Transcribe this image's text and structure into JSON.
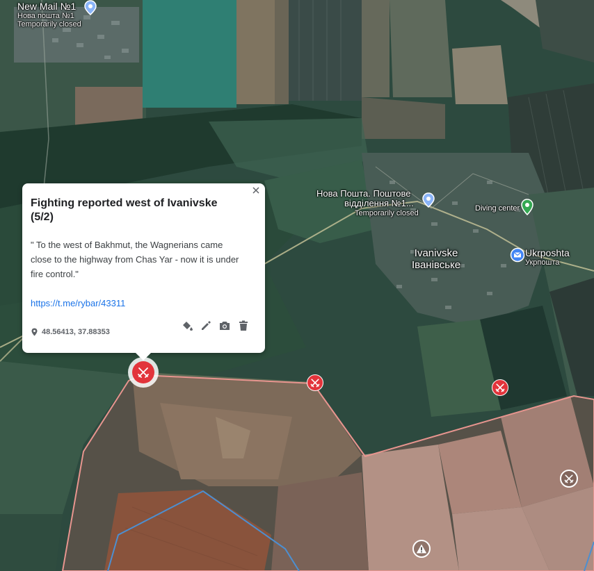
{
  "places": [
    {
      "id": "newmail",
      "line1": "New Mail №1",
      "line2": "Нова пошта №1",
      "line3": "Temporarily closed"
    },
    {
      "id": "novaposhta",
      "line1": "Нова Пошта. Поштове",
      "line2": "відділення №1...",
      "line3": "Temporarily closed"
    },
    {
      "id": "diving",
      "line1": "Diving center"
    },
    {
      "id": "ukrposhta",
      "line1": "Ukrposhta",
      "line2": "Укрпошта"
    }
  ],
  "town": {
    "name_en": "Ivanivske",
    "name_uk": "Іванівське"
  },
  "popup": {
    "title": "Fighting reported west of Ivanivske (5/2)",
    "description": "\" To the west of Bakhmut, the Wagnerians came close to the highway from Chas Yar - now it is under fire control.\"",
    "link": "https://t.me/rybar/43311",
    "coordinates": "48.56413, 37.88353"
  },
  "markers": {
    "battle": "battle-crossed-swords-icon",
    "selected": "battle-crossed-swords-icon",
    "warning": "warning-icon"
  },
  "colors": {
    "battle_marker": "#e2343b",
    "red_zone_outline": "#e8958f",
    "blue_line": "#4c8fd1",
    "link": "#1a73e8",
    "diving_pin": "#34a853",
    "ukrposhta_pin": "#4285f4"
  }
}
